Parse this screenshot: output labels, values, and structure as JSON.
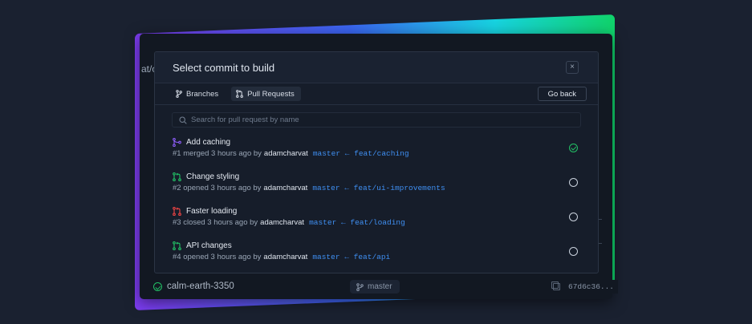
{
  "background_card": {
    "ghost_text": "at/c",
    "footer": {
      "project_name": "calm-earth-3350",
      "branch": "master",
      "sha": "67d6c36..."
    }
  },
  "modal": {
    "title": "Select commit to build",
    "close_label": "×",
    "tabs": [
      {
        "label": "Branches",
        "icon": "branch-icon",
        "active": false
      },
      {
        "label": "Pull Requests",
        "icon": "pull-request-icon",
        "active": true
      }
    ],
    "go_back_label": "Go back",
    "search": {
      "placeholder": "Search for pull request by name",
      "value": ""
    },
    "pull_requests": [
      {
        "title": "Add caching",
        "meta": "#1 merged 3 hours ago by",
        "author": "adamcharvat",
        "branches": "master ← feat/caching",
        "state": "merged",
        "icon": "merged-icon",
        "icon_color": "#8b5cf6",
        "selected": true
      },
      {
        "title": "Change styling",
        "meta": "#2 opened 3 hours ago by",
        "author": "adamcharvat",
        "branches": "master ← feat/ui-improvements",
        "state": "open",
        "icon": "pull-request-open-icon",
        "icon_color": "#22c065",
        "selected": false
      },
      {
        "title": "Faster loading",
        "meta": "#3 closed 3 hours ago by",
        "author": "adamcharvat",
        "branches": "master ← feat/loading",
        "state": "closed",
        "icon": "pull-request-closed-icon",
        "icon_color": "#ef4444",
        "selected": false
      },
      {
        "title": "API changes",
        "meta": "#4 opened 3 hours ago by",
        "author": "adamcharvat",
        "branches": "master ← feat/api",
        "state": "open",
        "icon": "pull-request-open-icon",
        "icon_color": "#22c065",
        "selected": false
      }
    ]
  },
  "colors": {
    "accent_blue": "#3f8ff2",
    "success_green": "#22c065",
    "merged_purple": "#8b5cf6",
    "closed_red": "#ef4444"
  }
}
